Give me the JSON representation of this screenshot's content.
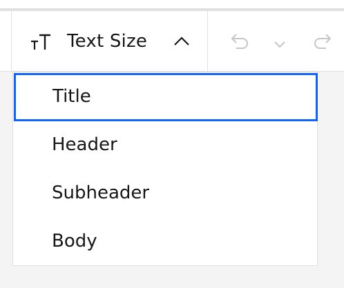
{
  "toolbar": {
    "text_size_label": "Text Size",
    "text_size_icon": "text-size-icon",
    "chevron_icon": "chevron-up-icon",
    "undo_icon": "undo-icon",
    "undo_menu_icon": "chevron-down-icon",
    "redo_icon": "redo-icon"
  },
  "dropdown": {
    "options": [
      {
        "label": "Title",
        "selected": true
      },
      {
        "label": "Header",
        "selected": false
      },
      {
        "label": "Subheader",
        "selected": false
      },
      {
        "label": "Body",
        "selected": false
      }
    ]
  },
  "colors": {
    "accent": "#0f62fe",
    "text": "#161616",
    "disabled_icon": "#c6c6c6",
    "border": "#e0e0e0",
    "background": "#f4f4f4"
  }
}
